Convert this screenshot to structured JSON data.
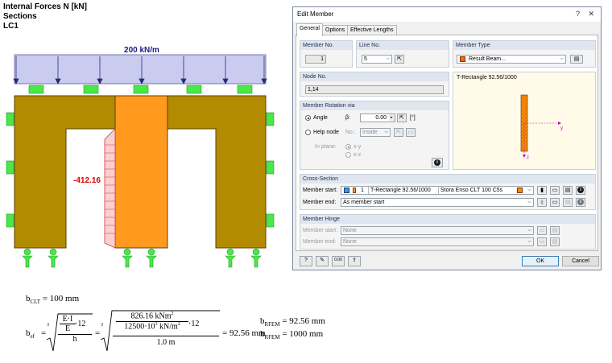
{
  "header": {
    "line1": "Internal Forces N [kN]",
    "line2": "Sections",
    "line3": "LC1"
  },
  "model": {
    "load_label": "200 kN/m",
    "force_value": "-412.16",
    "colors": {
      "wall": "#b38b00",
      "column": "#ff9a1f",
      "load": "#c9cbef",
      "support": "#48e848",
      "diagram": "#e03030"
    }
  },
  "dialog": {
    "title": "Edit Member",
    "tabs": [
      "General",
      "Options",
      "Effective Lengths"
    ],
    "member_no": {
      "label": "Member No.",
      "value": "1"
    },
    "line_no": {
      "label": "Line No.",
      "value": "5"
    },
    "member_type": {
      "label": "Member Type",
      "value": "Result Beam..."
    },
    "node_no": {
      "label": "Node No.",
      "value": "1,14"
    },
    "rotation": {
      "title": "Member Rotation via",
      "angle_label": "Angle",
      "beta_label": "β:",
      "beta_value": "0.00",
      "beta_unit": "[°]",
      "help_node_label": "Help node",
      "no_label": "No.:",
      "inside_value": "Inside",
      "in_plane_label": "In plane:",
      "xy": "x-y",
      "xz": "x-z"
    },
    "preview": {
      "title": "T-Rectangle 92.56/1000",
      "y_axis": "y",
      "z_axis": "z"
    },
    "cross_section": {
      "title": "Cross-Section",
      "start_label": "Member start:",
      "start_no": "1",
      "start_value": "T-Rectangle 92.56/1000",
      "start_material": "Stora Enso CLT 100 C5s",
      "end_label": "Member end:",
      "end_value": "As member start"
    },
    "hinge": {
      "title": "Member Hinge",
      "start_label": "Member start:",
      "start_value": "None",
      "end_label": "Member end:",
      "end_value": "None"
    },
    "ok_label": "OK",
    "cancel_label": "Cancel",
    "icon_value_label": "0.00"
  },
  "formula": {
    "b_clt_sym": "b",
    "b_clt_sub": "CLT",
    "b_clt_val": "= 100 mm",
    "b_ef_sym": "b",
    "b_ef_sub": "ef",
    "eq": "=",
    "root_index": "3",
    "frac_num_num": "E·I",
    "frac_num_den": "E",
    "times_12": "·12",
    "frac_den": "h",
    "num_val": "826.16 kNm",
    "num_exp": "2",
    "den_val": "12500·10",
    "den_exp": "3",
    "den_unit": " kN/m",
    "den_unit_exp": "2",
    "den2": "1.0 m",
    "result": "= 92.56 mm",
    "b_rfem_sym": "b",
    "b_rfem_sub": "RFEM",
    "b_rfem_val": "= 92.56 mm",
    "h_rfem_sym": "h",
    "h_rfem_sub": "RFEM",
    "h_rfem_val": "= 1000 mm"
  }
}
